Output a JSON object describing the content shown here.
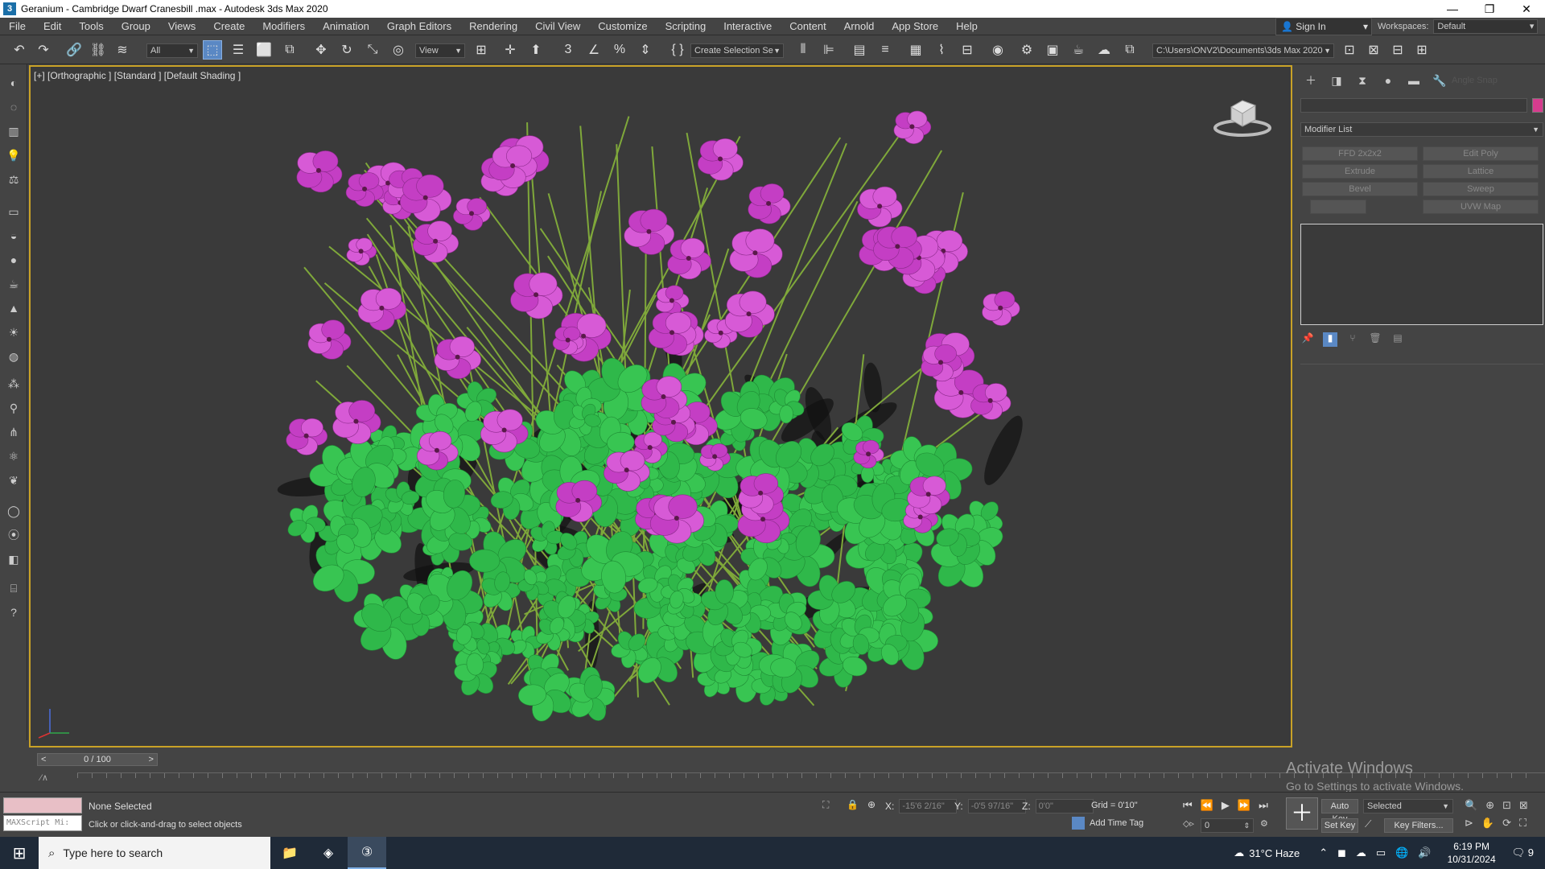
{
  "window": {
    "title": "Geranium - Cambridge Dwarf Cranesbill .max - Autodesk 3ds Max 2020",
    "app_icon": "3"
  },
  "menu": [
    "File",
    "Edit",
    "Tools",
    "Group",
    "Views",
    "Create",
    "Modifiers",
    "Animation",
    "Graph Editors",
    "Rendering",
    "Civil View",
    "Customize",
    "Scripting",
    "Interactive",
    "Content",
    "Arnold",
    "App Store",
    "Help"
  ],
  "account": {
    "signin": "Sign In",
    "workspace_label": "Workspaces:",
    "workspace_value": "Default"
  },
  "toolbar": {
    "filter": "All",
    "ref_coord": "View",
    "selection_set": "Create Selection Se",
    "project_path": "C:\\Users\\ONV2\\Documents\\3ds Max 2020"
  },
  "viewport": {
    "label": "[+] [Orthographic ] [Standard ] [Default Shading ]"
  },
  "command_panel": {
    "modifier_list": "Modifier List",
    "buttons": [
      "FFD 2x2x2",
      "Edit Poly",
      "Extrude",
      "Lattice",
      "Bevel",
      "Sweep",
      "",
      "UVW Map"
    ],
    "hidden_label": "Angle Snap"
  },
  "timeline": {
    "frame": "0 / 100"
  },
  "status": {
    "selection": "None Selected",
    "prompt": "Click or click-and-drag to select objects",
    "maxscript": "MAXScript Mi:",
    "x_label": "X:",
    "x_value": "-15'6 2/16\"",
    "y_label": "Y:",
    "y_value": "-0'5 97/16\"",
    "z_label": "Z:",
    "z_value": "0'0\"",
    "grid": "Grid = 0'10\"",
    "add_time_tag": "Add Time Tag",
    "auto_key": "Auto Key",
    "set_key": "Set Key",
    "selected": "Selected",
    "key_filters": "Key Filters...",
    "frame_field": "0"
  },
  "activation": {
    "line1": "Activate Windows",
    "line2": "Go to Settings to activate Windows."
  },
  "taskbar": {
    "search_placeholder": "Type here to search",
    "weather": "31°C  Haze",
    "time": "6:19 PM",
    "date": "10/31/2024",
    "notifications": "9"
  },
  "colors": {
    "accent": "#5a88c4",
    "viewport_border": "#c9a227",
    "object_color": "#d63c8e",
    "flower": "#c43ec4",
    "leaf": "#2fb84a"
  }
}
